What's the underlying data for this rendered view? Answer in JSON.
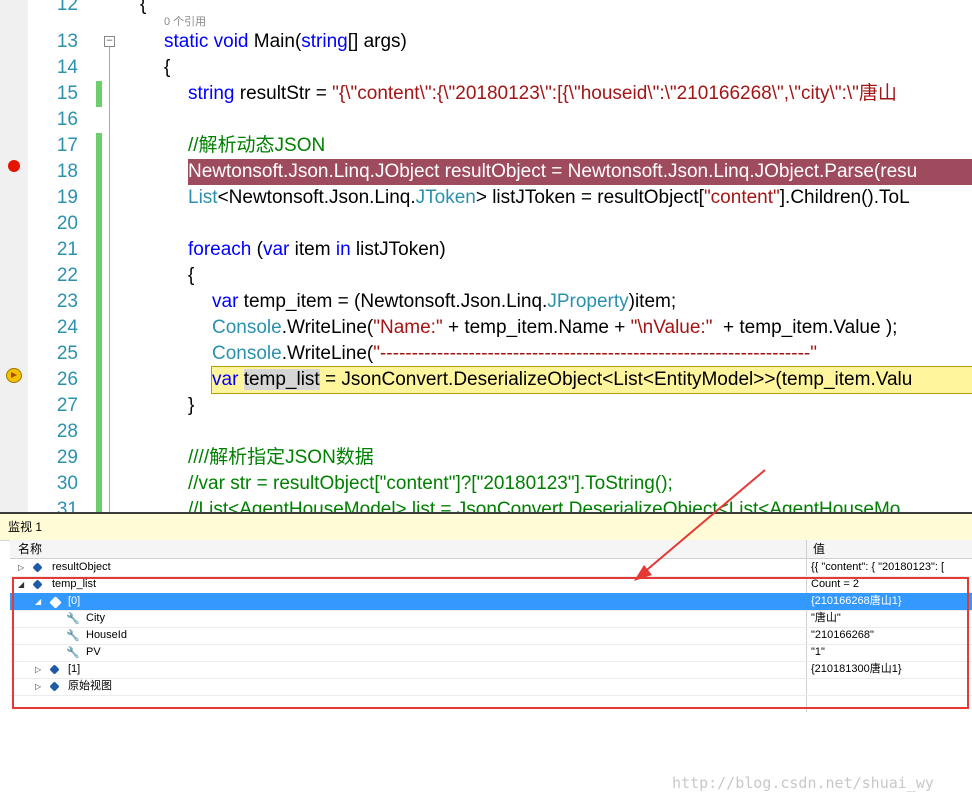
{
  "editor": {
    "line_numbers": [
      "12",
      "13",
      "14",
      "15",
      "16",
      "17",
      "18",
      "19",
      "20",
      "21",
      "22",
      "23",
      "24",
      "25",
      "26",
      "27",
      "28",
      "29",
      "30",
      "31"
    ],
    "ref_count": "0 个引用",
    "lines": {
      "l12": "{",
      "l13_kw": "static void",
      "l13_rest": " Main(",
      "l13_type": "string",
      "l13_end": "[] args)",
      "l14": "{",
      "l15_kw": "string",
      "l15_mid": " resultStr = ",
      "l15_str": "\"{\\\"content\\\":{\\\"20180123\\\":[{\\\"houseid\\\":\\\"210166268\\\",\\\"city\\\":\\\"唐山",
      "l17": "//解析动态JSON",
      "l18": "Newtonsoft.Json.Linq.JObject resultObject = Newtonsoft.Json.Linq.JObject.Parse(resu",
      "l19_a": "List",
      "l19_b": "<Newtonsoft.Json.Linq.",
      "l19_c": "JToken",
      "l19_d": "> listJToken = resultObject[",
      "l19_e": "\"content\"",
      "l19_f": "].Children().ToL",
      "l21_a": "foreach",
      "l21_b": " (",
      "l21_c": "var",
      "l21_d": " item ",
      "l21_e": "in",
      "l21_f": " listJToken)",
      "l22": "{",
      "l23_a": "var",
      "l23_b": " temp_item = (Newtonsoft.Json.Linq.",
      "l23_c": "JProperty",
      "l23_d": ")item;",
      "l24_a": "Console",
      "l24_b": ".WriteLine(",
      "l24_c": "\"Name:\"",
      "l24_d": " + temp_item.Name + ",
      "l24_e": "\"\\nValue:\"",
      "l24_f": "  + temp_item.Value );",
      "l25_a": "Console",
      "l25_b": ".WriteLine(",
      "l25_c": "\"--------------------------------------------------------------------\"",
      "l26_a": "var",
      "l26_b": "temp_list",
      "l26_c": " = JsonConvert.DeserializeObject<List<EntityModel>>(temp_item.Valu",
      "l27": "}",
      "l29": "////解析指定JSON数据",
      "l30": "//var str = resultObject[\"content\"]?[\"20180123\"].ToString();",
      "l31": "//List<AgentHouseModel> list = JsonConvert.DeserializeObject<List<AgentHouseMo"
    }
  },
  "watch": {
    "title": "监视 1",
    "col_name": "名称",
    "col_value": "值",
    "rows": [
      {
        "name": "resultObject",
        "value": "{{  \"content\": {    \"20180123\": ["
      },
      {
        "name": "temp_list",
        "value": "Count = 2"
      },
      {
        "name": "[0]",
        "value": "{210166268唐山1}"
      },
      {
        "name": "City",
        "value": "\"唐山\""
      },
      {
        "name": "HouseId",
        "value": "\"210166268\""
      },
      {
        "name": "PV",
        "value": "\"1\""
      },
      {
        "name": "[1]",
        "value": "{210181300唐山1}"
      },
      {
        "name": "原始视图",
        "value": ""
      }
    ],
    "watermark": "http://blog.csdn.net/shuai_wy"
  },
  "colors": {
    "keyword": "#0000ff",
    "type": "#2b91af",
    "string": "#a31515",
    "comment": "#008000",
    "breakpoint_line": "#9f4b5e",
    "current_line": "#fff59d",
    "selection": "#3399ff",
    "annotation": "#e53935"
  },
  "icons": [
    "breakpoint-icon",
    "current-statement-arrow-icon",
    "collapse-icon",
    "expand-triangle-icon",
    "object-icon",
    "property-wrench-icon"
  ]
}
